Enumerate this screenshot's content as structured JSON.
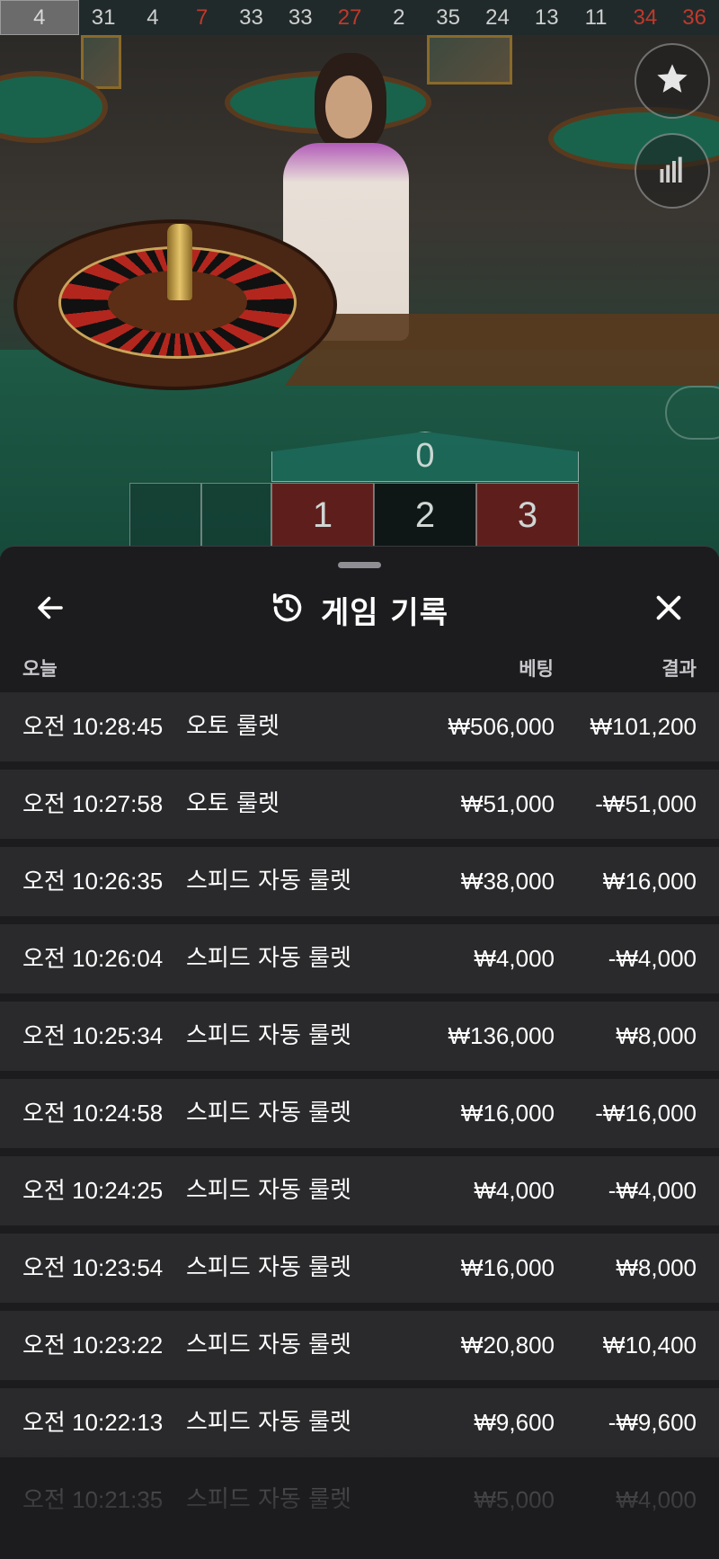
{
  "recent_results": [
    {
      "value": "4",
      "color": "black"
    },
    {
      "value": "31",
      "color": "black"
    },
    {
      "value": "4",
      "color": "black"
    },
    {
      "value": "7",
      "color": "red"
    },
    {
      "value": "33",
      "color": "black"
    },
    {
      "value": "33",
      "color": "black"
    },
    {
      "value": "27",
      "color": "red"
    },
    {
      "value": "2",
      "color": "black"
    },
    {
      "value": "35",
      "color": "black"
    },
    {
      "value": "24",
      "color": "black"
    },
    {
      "value": "13",
      "color": "black"
    },
    {
      "value": "11",
      "color": "black"
    },
    {
      "value": "34",
      "color": "red"
    },
    {
      "value": "36",
      "color": "red"
    }
  ],
  "side_buttons": {
    "favorite_icon": "star-icon",
    "stats_icon": "bar-chart-icon"
  },
  "betting_grid": {
    "zero": "0",
    "numbers": [
      {
        "value": "1",
        "color": "red"
      },
      {
        "value": "2",
        "color": "black"
      },
      {
        "value": "3",
        "color": "red"
      }
    ]
  },
  "history": {
    "title": "게임 기록",
    "title_icon": "history-icon",
    "back_icon": "arrow-left-icon",
    "close_icon": "close-icon",
    "columns": {
      "date": "오늘",
      "bet": "베팅",
      "result": "결과"
    },
    "rows": [
      {
        "time": "오전 10:28:45",
        "game": "오토 룰렛",
        "bet": "₩506,000",
        "result": "₩101,200"
      },
      {
        "time": "오전 10:27:58",
        "game": "오토 룰렛",
        "bet": "₩51,000",
        "result": "-₩51,000"
      },
      {
        "time": "오전 10:26:35",
        "game": "스피드 자동 룰렛",
        "bet": "₩38,000",
        "result": "₩16,000"
      },
      {
        "time": "오전 10:26:04",
        "game": "스피드 자동 룰렛",
        "bet": "₩4,000",
        "result": "-₩4,000"
      },
      {
        "time": "오전 10:25:34",
        "game": "스피드 자동 룰렛",
        "bet": "₩136,000",
        "result": "₩8,000"
      },
      {
        "time": "오전 10:24:58",
        "game": "스피드 자동 룰렛",
        "bet": "₩16,000",
        "result": "-₩16,000"
      },
      {
        "time": "오전 10:24:25",
        "game": "스피드 자동 룰렛",
        "bet": "₩4,000",
        "result": "-₩4,000"
      },
      {
        "time": "오전 10:23:54",
        "game": "스피드 자동 룰렛",
        "bet": "₩16,000",
        "result": "₩8,000"
      },
      {
        "time": "오전 10:23:22",
        "game": "스피드 자동 룰렛",
        "bet": "₩20,800",
        "result": "₩10,400"
      },
      {
        "time": "오전 10:22:13",
        "game": "스피드 자동 룰렛",
        "bet": "₩9,600",
        "result": "-₩9,600"
      },
      {
        "time": "오전 10:21:35",
        "game": "스피드 자동 룰렛",
        "bet": "₩5,000",
        "result": "₩4,000"
      }
    ]
  },
  "colors": {
    "red": "#c0392b",
    "sheet_bg": "#1c1c1e",
    "row_bg": "#2a2a2c",
    "felt": "#1e5a46"
  }
}
